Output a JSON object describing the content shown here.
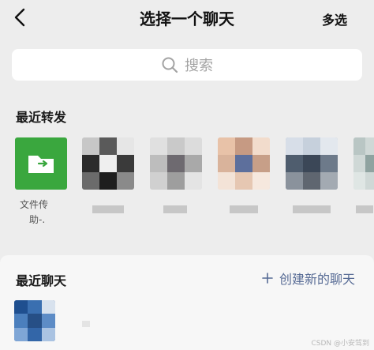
{
  "header": {
    "title": "选择一个聊天",
    "multi_select_label": "多选"
  },
  "search": {
    "placeholder": "搜索"
  },
  "recent_forward": {
    "title": "最近转发",
    "items": [
      {
        "label_line1": "文件传",
        "label_line2": "助-."
      }
    ]
  },
  "recent_chats": {
    "title": "最近聊天",
    "create_label": "创建新的聊天"
  },
  "watermark": "CSDN @小安驾到",
  "colors": {
    "file_helper_green": "#3aa73e",
    "link_blue": "#576b95",
    "background": "#ededed"
  }
}
